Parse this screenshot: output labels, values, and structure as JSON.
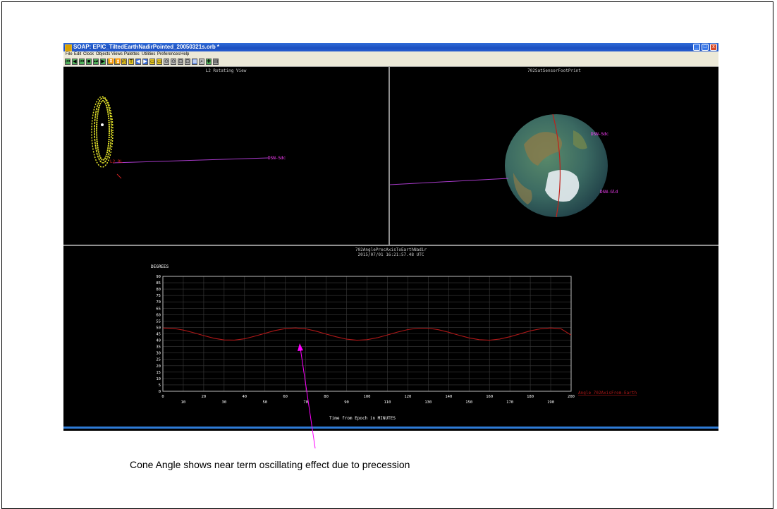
{
  "window": {
    "title": "SOAP: EPIC_TiltedEarthNadirPointed_20050321s.orb *",
    "controls": [
      "_",
      "□",
      "x"
    ]
  },
  "menu": [
    "File",
    "Edit",
    "Clock",
    "Objects",
    "Views",
    "Palettes",
    "Utilities",
    "Preferences",
    "Help"
  ],
  "toolbar": {
    "buttons": [
      "⏮",
      "◀",
      "⏮",
      "■",
      "⏭",
      "▶",
      "⏬",
      "⏫",
      "◴",
      "T",
      "◀",
      "▶",
      "▭",
      "▭",
      "⊙",
      "⊙",
      "⊡",
      "⊡",
      "▦",
      "⌕",
      "✚",
      "▤"
    ]
  },
  "views": {
    "rotating": {
      "title": "L2 Rotating View",
      "label_right": "DSN-Sdc",
      "label_left": "L2 RL"
    },
    "footprint": {
      "title": "702SatSensorFootPrint",
      "label_top": "DSN-Sdc",
      "label_bottom": "DSN-Gld"
    },
    "plot": {
      "title": "702AnglePrecAxisToEarthNadir",
      "timestamp": "2015/07/01 16:21:57.48 UTC"
    }
  },
  "chart_data": {
    "type": "line",
    "ylabel": "DEGREES",
    "xlabel": "Time from Epoch in MINUTES",
    "xlim": [
      0,
      200
    ],
    "ylim": [
      0,
      90
    ],
    "yticks": [
      0,
      5,
      10,
      15,
      20,
      25,
      30,
      35,
      40,
      45,
      50,
      55,
      60,
      65,
      70,
      75,
      80,
      85,
      90
    ],
    "xticks_top_row": [
      0,
      20,
      40,
      60,
      80,
      100,
      120,
      140,
      160,
      180,
      200
    ],
    "xticks_bottom_row": [
      10,
      30,
      50,
      70,
      90,
      110,
      130,
      150,
      170,
      190
    ],
    "grid": true,
    "series": [
      {
        "name": "Angle_702AxisFrom-Earth",
        "color": "#b01818",
        "x": [
          0,
          5,
          10,
          15,
          20,
          25,
          30,
          35,
          40,
          45,
          50,
          55,
          60,
          65,
          70,
          75,
          80,
          85,
          90,
          95,
          100,
          105,
          110,
          115,
          120,
          125,
          130,
          135,
          140,
          145,
          150,
          155,
          160,
          165,
          170,
          175,
          180,
          185,
          190,
          195,
          200
        ],
        "y": [
          49.5,
          49.3,
          47.9,
          45.9,
          43.6,
          41.5,
          40.2,
          40.1,
          41.1,
          43.1,
          45.4,
          47.6,
          49.1,
          49.6,
          48.9,
          47.1,
          44.8,
          42.6,
          40.8,
          40.0,
          40.4,
          41.9,
          44.1,
          46.4,
          48.3,
          49.4,
          49.4,
          48.2,
          46.2,
          43.9,
          41.8,
          40.4,
          40.0,
          40.9,
          42.7,
          45.0,
          47.3,
          48.9,
          49.6,
          49.0,
          44.0
        ]
      }
    ]
  },
  "annotation": {
    "caption": "Cone Angle shows near term oscillating effect due to precession",
    "arrow_color": "#ff00ff"
  }
}
